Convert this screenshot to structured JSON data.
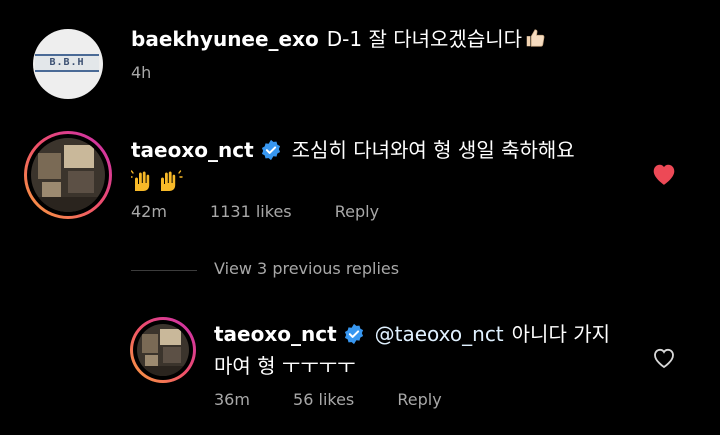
{
  "caption": {
    "avatar_text": "B.B.H",
    "username": "baekhyunee_exo",
    "text": "D-1 잘 다녀오겠습니다",
    "emoji": "thumbs-up-icon",
    "time": "4h"
  },
  "comments": [
    {
      "username": "taeoxo_nct",
      "verified": true,
      "text": "조심히 다녀와여 형 생일 축하해요",
      "emoji": "raising-hands-icon",
      "time": "42m",
      "likes": "1131 likes",
      "reply_label": "Reply",
      "liked": true
    }
  ],
  "view_replies": "View 3 previous replies",
  "reply": {
    "username": "taeoxo_nct",
    "verified": true,
    "mention": "@taeoxo_nct",
    "text_line1": "아니다 가지",
    "text_line2": "마여 형 ㅜㅜㅜㅜ",
    "time": "36m",
    "likes": "56 likes",
    "reply_label": "Reply",
    "liked": false
  },
  "colors": {
    "background": "#000000",
    "text": "#ffffff",
    "meta": "#a8a8a8",
    "like_red": "#ed4956",
    "verified_blue": "#3897f0"
  }
}
